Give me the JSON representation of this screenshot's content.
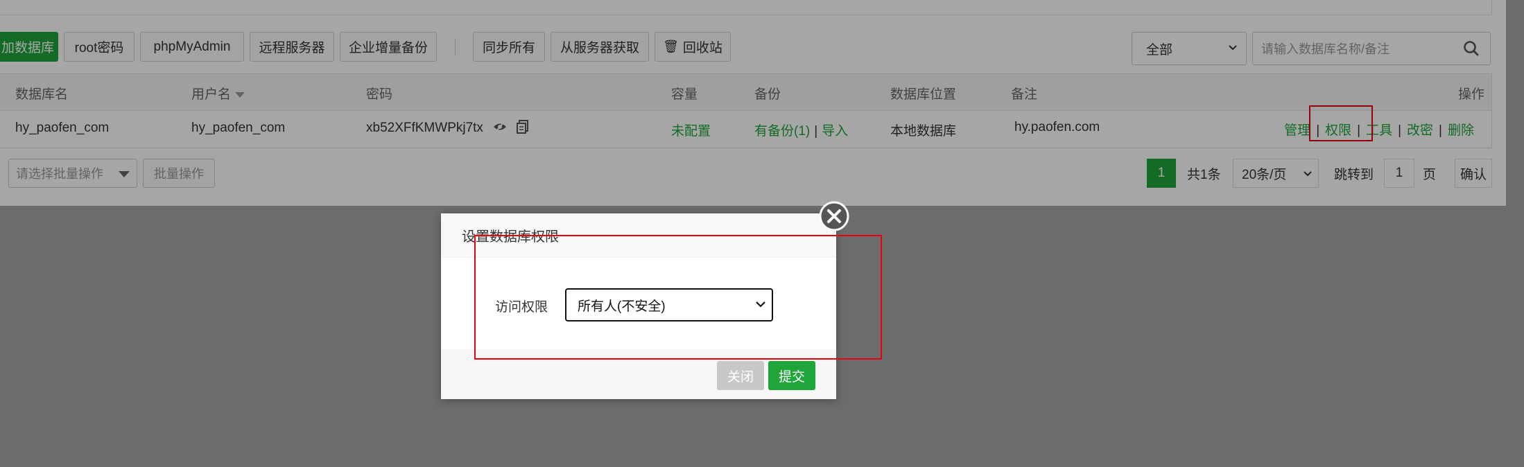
{
  "toolbar": {
    "add_db": "加数据库",
    "root_pwd": "root密码",
    "phpmyadmin": "phpMyAdmin",
    "remote_server": "远程服务器",
    "enterprise_backup": "企业增量备份",
    "sync_all": "同步所有",
    "fetch_from_server": "从服务器获取",
    "recycle_bin": "回收站"
  },
  "filter": {
    "selected": "全部",
    "search_placeholder": "请输入数据库名称/备注"
  },
  "table": {
    "headers": {
      "db_name": "数据库名",
      "username": "用户名",
      "password": "密码",
      "capacity": "容量",
      "backup": "备份",
      "location": "数据库位置",
      "remark": "备注",
      "actions": "操作"
    },
    "rows": [
      {
        "db_name": "hy_paofen_com",
        "username": "hy_paofen_com",
        "password": "xb52XFfKMWPkj7tx",
        "capacity": "未配置",
        "backup": "有备份(1)",
        "import": "导入",
        "location": "本地数据库",
        "remark": "hy.paofen.com",
        "actions": {
          "manage": "管理",
          "permission": "权限",
          "tools": "工具",
          "change_pwd": "改密",
          "delete": "删除"
        }
      }
    ]
  },
  "batch": {
    "placeholder": "请选择批量操作",
    "button": "批量操作"
  },
  "pagination": {
    "current": "1",
    "total": "共1条",
    "per_page": "20条/页",
    "goto_label": "跳转到",
    "goto_value": "1",
    "page_unit": "页",
    "confirm": "确认"
  },
  "dialog": {
    "title": "设置数据库权限",
    "field_label": "访问权限",
    "selected_option": "所有人(不安全)",
    "close": "关闭",
    "submit": "提交"
  },
  "colors": {
    "accent": "#20a53a",
    "highlight": "#e60012"
  }
}
